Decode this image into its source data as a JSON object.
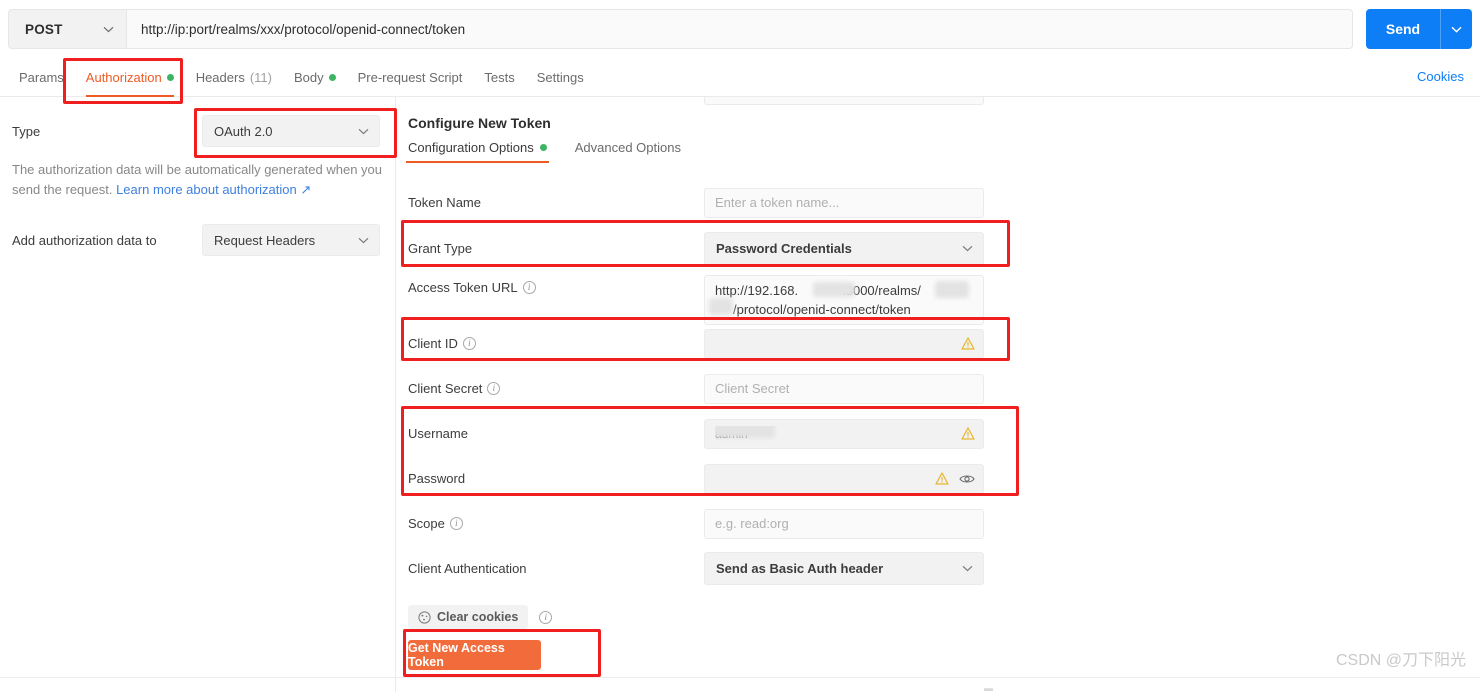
{
  "request_bar": {
    "method": "POST",
    "url": "http://ip:port/realms/xxx/protocol/openid-connect/token",
    "send_label": "Send"
  },
  "tabs": [
    {
      "label": "Params",
      "active": false,
      "indicator": "none"
    },
    {
      "label": "Authorization",
      "active": true,
      "indicator": "green-dot"
    },
    {
      "label": "Headers",
      "count": "(11)",
      "active": false,
      "indicator": "none"
    },
    {
      "label": "Body",
      "active": false,
      "indicator": "green-dot"
    },
    {
      "label": "Pre-request Script",
      "active": false,
      "indicator": "none"
    },
    {
      "label": "Tests",
      "active": false,
      "indicator": "none"
    },
    {
      "label": "Settings",
      "active": false,
      "indicator": "none"
    }
  ],
  "cookies_link": "Cookies",
  "left_panel": {
    "type_label": "Type",
    "type_value": "OAuth 2.0",
    "help_text": "The authorization data will be automatically generated when you send the request. ",
    "help_link": "Learn more about authorization",
    "add_auth_label": "Add authorization data to",
    "add_auth_value": "Request Headers"
  },
  "right_panel": {
    "title": "Configure New Token",
    "subtabs": [
      {
        "label": "Configuration Options",
        "active": true,
        "indicator": "green-dot"
      },
      {
        "label": "Advanced Options",
        "active": false,
        "indicator": "none"
      }
    ],
    "fields": {
      "token_name": {
        "label": "Token Name",
        "placeholder": "Enter a token name...",
        "value": ""
      },
      "grant_type": {
        "label": "Grant Type",
        "value": "Password Credentials"
      },
      "access_token_url": {
        "label": "Access Token URL",
        "has_info": true,
        "line1": "http://192.168.",
        "line1_mid": ":8000/realms/",
        "line2": "/protocol/openid-connect/token"
      },
      "client_id": {
        "label": "Client ID",
        "has_info": true,
        "value": "",
        "redacted": true,
        "warning": true
      },
      "client_secret": {
        "label": "Client Secret",
        "has_info": true,
        "placeholder": "Client Secret",
        "value": ""
      },
      "username": {
        "label": "Username",
        "value": "admin",
        "redacted": true,
        "warning": true
      },
      "password": {
        "label": "Password",
        "value": "",
        "redacted": true,
        "warning": true,
        "has_eye": true
      },
      "scope": {
        "label": "Scope",
        "has_info": true,
        "placeholder": "e.g. read:org",
        "value": ""
      },
      "client_authentication": {
        "label": "Client Authentication",
        "value": "Send as Basic Auth header"
      }
    },
    "clear_cookies_label": "Clear cookies",
    "get_token_label": "Get New Access Token"
  },
  "watermark": "CSDN @刀下阳光",
  "colors": {
    "accent_orange": "#ef5b25",
    "send_blue": "#0d7ef5",
    "link_blue": "#3f7fe0",
    "green_dot": "#3cb464",
    "annotation_red": "#f01f1f",
    "warning_yellow": "#e8b730",
    "button_orange": "#f26b3a"
  }
}
